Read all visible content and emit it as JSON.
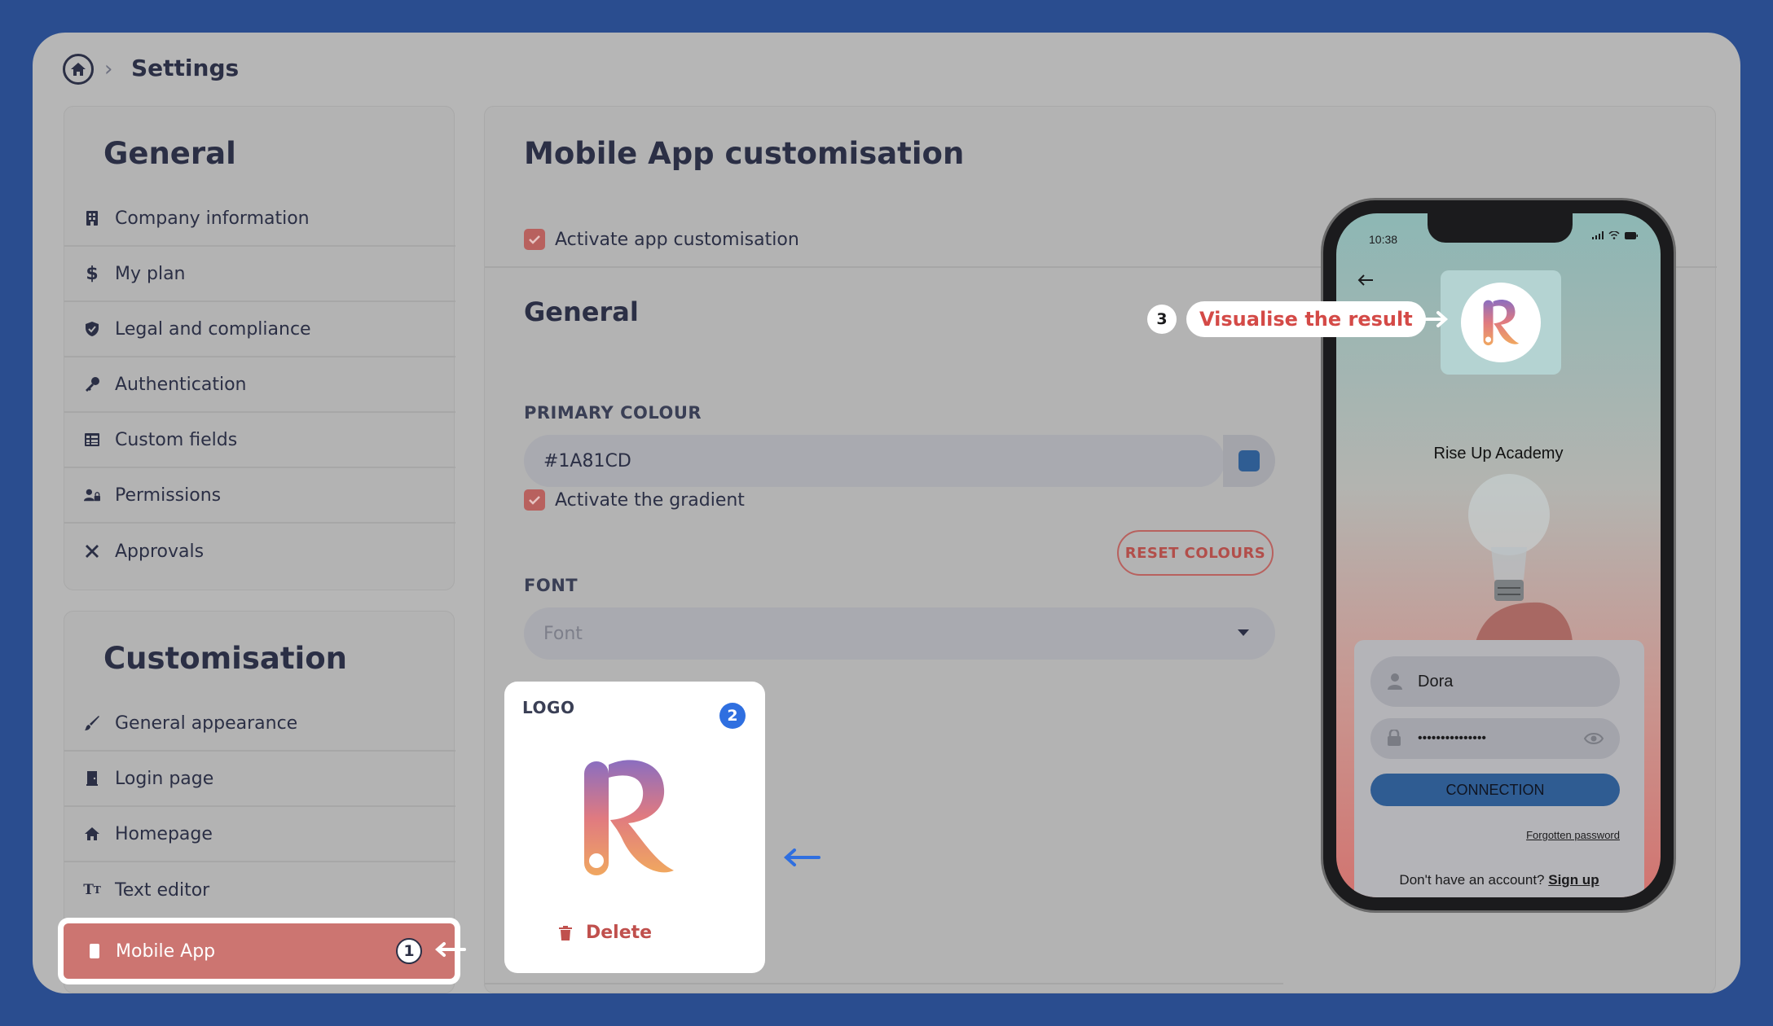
{
  "breadcrumb": {
    "title": "Settings"
  },
  "sidebar": {
    "general_heading": "General",
    "general_items": [
      {
        "label": "Company information",
        "icon": "building-icon"
      },
      {
        "label": "My plan",
        "icon": "dollar-icon"
      },
      {
        "label": "Legal and compliance",
        "icon": "shield-icon"
      },
      {
        "label": "Authentication",
        "icon": "key-icon"
      },
      {
        "label": "Custom fields",
        "icon": "table-icon"
      },
      {
        "label": "Permissions",
        "icon": "user-lock-icon"
      },
      {
        "label": "Approvals",
        "icon": "tools-icon"
      }
    ],
    "custom_heading": "Customisation",
    "custom_items": [
      {
        "label": "General appearance",
        "icon": "brush-icon"
      },
      {
        "label": "Login page",
        "icon": "door-icon"
      },
      {
        "label": "Homepage",
        "icon": "home-icon"
      },
      {
        "label": "Text editor",
        "icon": "text-size-icon"
      },
      {
        "label": "Mobile App",
        "icon": "mobile-icon",
        "active": true
      }
    ]
  },
  "main": {
    "title": "Mobile App customisation",
    "activate_label": "Activate app customisation",
    "section_title": "General",
    "primary_colour_label": "PRIMARY COLOUR",
    "primary_colour_value": "#1A81CD",
    "swatch_color": "#2f5d93",
    "gradient_label": "Activate the gradient",
    "reset_label": "RESET COLOURS",
    "font_label": "FONT",
    "font_placeholder": "Font",
    "logo_label": "LOGO",
    "delete_label": "Delete"
  },
  "phone": {
    "time": "10:38",
    "app_name": "Rise Up Academy",
    "username_value": "Dora",
    "password_value": "•••••••••••••••",
    "connect_label": "CONNECTION",
    "forgot_label": "Forgotten password",
    "no_account_text": "Don't have an account?",
    "signup_label": "Sign up"
  },
  "annotations": {
    "badge_1": "1",
    "badge_2": "2",
    "badge_3": "3",
    "callout_text": "Visualise the result"
  },
  "colors": {
    "accent": "#cc7571",
    "badge_blue": "#2f6fe0",
    "callout_red": "#d44a47"
  }
}
